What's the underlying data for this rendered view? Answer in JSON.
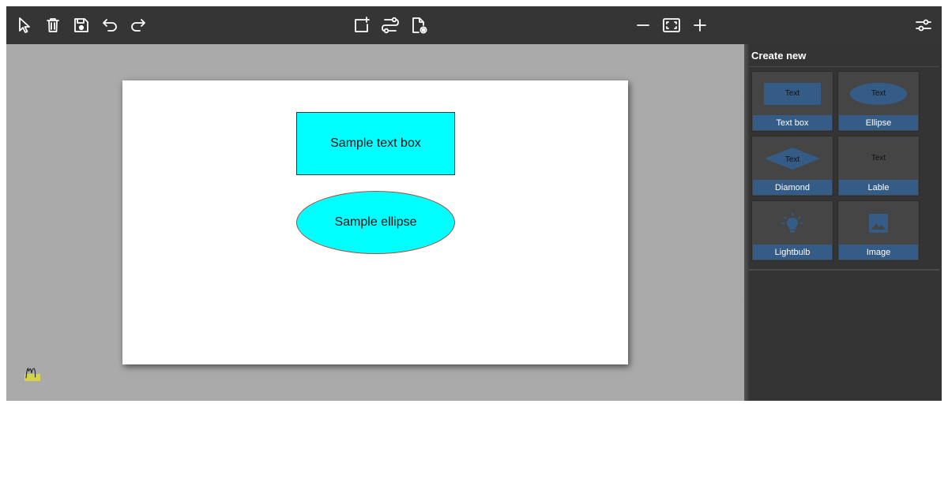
{
  "toolbar": {
    "left_tools": [
      {
        "name": "select-tool",
        "icon": "cursor-arrow-icon"
      },
      {
        "name": "delete",
        "icon": "trash-icon"
      },
      {
        "name": "save",
        "icon": "floppy-disk-icon"
      },
      {
        "name": "undo",
        "icon": "undo-icon"
      },
      {
        "name": "redo",
        "icon": "redo-icon"
      }
    ],
    "center_tools": [
      {
        "name": "add-page",
        "icon": "add-box-icon"
      },
      {
        "name": "connections",
        "icon": "route-icon"
      },
      {
        "name": "document-settings",
        "icon": "file-settings-icon"
      }
    ],
    "zoom_tools": [
      {
        "name": "zoom-out",
        "icon": "minus-icon"
      },
      {
        "name": "fit-to-screen",
        "icon": "fit-screen-icon"
      },
      {
        "name": "zoom-in",
        "icon": "plus-icon"
      }
    ],
    "right_tools": [
      {
        "name": "properties",
        "icon": "sliders-icon"
      }
    ]
  },
  "canvas": {
    "shapes": {
      "textbox": {
        "text": "Sample text box",
        "fill": "#00ffff",
        "stroke": "#1f3c46"
      },
      "ellipse": {
        "text": "Sample ellipse",
        "fill": "#00ffff",
        "stroke": "#b04a3a"
      }
    },
    "logo_icon": "brand-logo-icon"
  },
  "sidebar": {
    "title": "Create new",
    "tiles": [
      {
        "label": "Text box",
        "preview_text": "Text",
        "preview": "box"
      },
      {
        "label": "Ellipse",
        "preview_text": "Text",
        "preview": "ellipse"
      },
      {
        "label": "Diamond",
        "preview_text": "Text",
        "preview": "diamond"
      },
      {
        "label": "Lable",
        "preview_text": "Text",
        "preview": "label"
      },
      {
        "label": "Lightbulb",
        "preview_text": "",
        "preview": "lightbulb-icon"
      },
      {
        "label": "Image",
        "preview_text": "",
        "preview": "image-icon"
      }
    ]
  },
  "colors": {
    "toolbar_bg": "#353535",
    "canvas_bg": "#aaaaaa",
    "sidebar_bg": "#343434",
    "tile_bg": "#454545",
    "accent": "#355c86"
  }
}
